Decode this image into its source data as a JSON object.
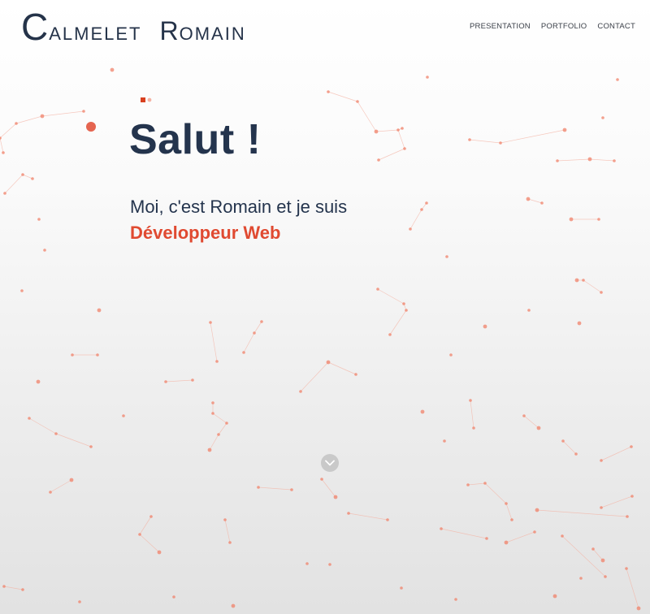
{
  "header": {
    "logo": {
      "first_initial": "C",
      "first_rest": "ALMELET",
      "last_initial": "R",
      "last_rest": "OMAIN"
    },
    "nav": [
      {
        "label": "PRESENTATION"
      },
      {
        "label": "PORTFOLIO"
      },
      {
        "label": "CONTACT"
      }
    ]
  },
  "hero": {
    "title": "Salut !",
    "subtitle": "Moi, c'est Romain et je suis",
    "role": "Développeur Web"
  },
  "scroll_button": {
    "icon": "chevron-down-icon"
  },
  "colors": {
    "primary": "#24344d",
    "accent": "#e04a31",
    "particle": "#f0826a",
    "link": "#f4b3a4"
  }
}
